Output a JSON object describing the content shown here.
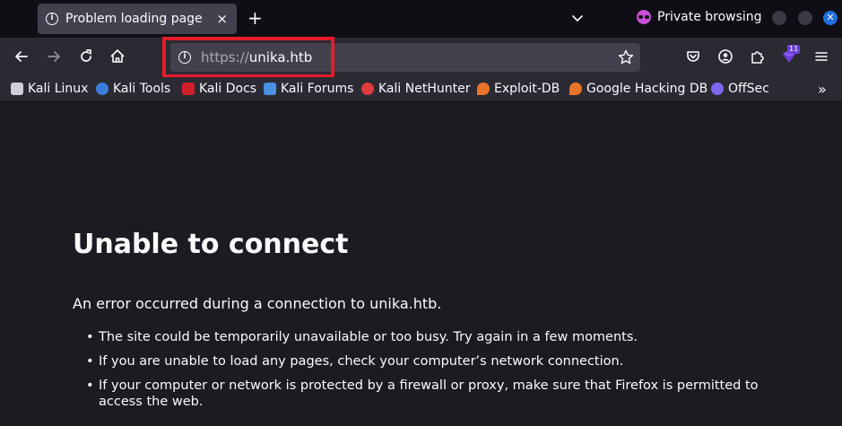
{
  "tab": {
    "title": "Problem loading page",
    "close_glyph": "×",
    "info_glyph": "i"
  },
  "tabstrip": {
    "new_tab_glyph": "+",
    "private_label": "Private browsing",
    "close_window_glyph": "✕"
  },
  "navbar": {
    "url_scheme": "https://",
    "url_host": "unika.htb",
    "extension_badge": "11"
  },
  "bookmarks": {
    "items": [
      {
        "label": "Kali Linux",
        "icon": "kali-dragon-icon",
        "color": "#cfcfd8"
      },
      {
        "label": "Kali Tools",
        "icon": "kali-tools-icon",
        "color": "#3b7ddd"
      },
      {
        "label": "Kali Docs",
        "icon": "kali-docs-icon",
        "color": "#d0202a"
      },
      {
        "label": "Kali Forums",
        "icon": "kali-forums-icon",
        "color": "#4a90e2"
      },
      {
        "label": "Kali NetHunter",
        "icon": "kali-nethunter-icon",
        "color": "#e03b3b"
      },
      {
        "label": "Exploit-DB",
        "icon": "exploit-db-icon",
        "color": "#e8742a"
      },
      {
        "label": "Google Hacking DB",
        "icon": "ghdb-icon",
        "color": "#e8742a"
      },
      {
        "label": "OffSec",
        "icon": "offsec-icon",
        "color": "#7b68ee"
      }
    ],
    "more_glyph": "»"
  },
  "error": {
    "title": "Unable to connect",
    "description": "An error occurred during a connection to unika.htb.",
    "bullets": [
      "The site could be temporarily unavailable or too busy. Try again in a few moments.",
      "If you are unable to load any pages, check your computer’s network connection.",
      "If your computer or network is protected by a firewall or proxy, make sure that Firefox is permitted to access the web."
    ]
  },
  "colors": {
    "tabstrip_bg": "#0f0e15",
    "toolbar_bg": "#2b2a33",
    "urlbar_bg": "#42414d",
    "content_bg": "#1c1b22",
    "highlight_box": "#e61c28",
    "private_accent": "#c94fd6",
    "close_window_accent": "#1e6fe0"
  }
}
